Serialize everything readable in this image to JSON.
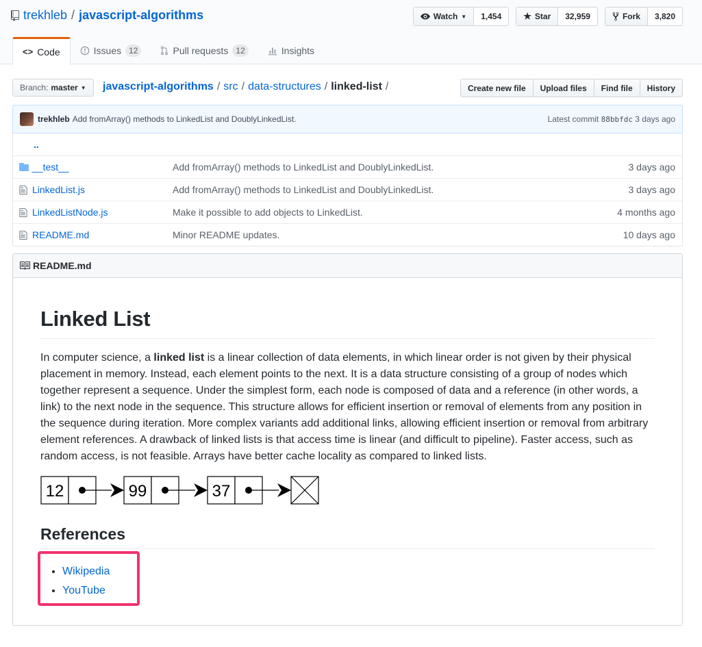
{
  "repo": {
    "owner": "trekhleb",
    "separator": "/",
    "name": "javascript-algorithms"
  },
  "actions": [
    {
      "label": "Watch",
      "icon": "eye-icon",
      "caret": true,
      "count": "1,454"
    },
    {
      "label": "Star",
      "icon": "star-icon",
      "caret": false,
      "count": "32,959"
    },
    {
      "label": "Fork",
      "icon": "fork-icon",
      "caret": false,
      "count": "3,820"
    }
  ],
  "nav": [
    {
      "label": "Code",
      "icon": "code-icon",
      "count": ""
    },
    {
      "label": "Issues",
      "icon": "issue-icon",
      "count": "12"
    },
    {
      "label": "Pull requests",
      "icon": "pull-request-icon",
      "count": "12"
    },
    {
      "label": "Insights",
      "icon": "graph-icon",
      "count": ""
    }
  ],
  "branch": {
    "label": "Branch:",
    "value": "master"
  },
  "breadcrumb": {
    "root": "javascript-algorithms",
    "segments": [
      "src",
      "data-structures"
    ],
    "current": "linked-list"
  },
  "file_buttons": [
    "Create new file",
    "Upload files",
    "Find file",
    "History"
  ],
  "commit": {
    "author": "trekhleb",
    "message": "Add fromArray() methods to LinkedList and DoublyLinkedList.",
    "latest_label": "Latest commit",
    "sha": "88bbfdc",
    "age": "3 days ago"
  },
  "files": [
    {
      "type": "dir",
      "name": "__test__",
      "message": "Add fromArray() methods to LinkedList and DoublyLinkedList.",
      "age": "3 days ago"
    },
    {
      "type": "file",
      "name": "LinkedList.js",
      "message": "Add fromArray() methods to LinkedList and DoublyLinkedList.",
      "age": "3 days ago"
    },
    {
      "type": "file",
      "name": "LinkedListNode.js",
      "message": "Make it possible to add objects to LinkedList.",
      "age": "4 months ago"
    },
    {
      "type": "file",
      "name": "README.md",
      "message": "Minor README updates.",
      "age": "10 days ago"
    }
  ],
  "up_link": "..",
  "readme": {
    "filename": "README.md",
    "title": "Linked List",
    "para_pre": "In computer science, a ",
    "para_bold": "linked list",
    "para_post": " is a linear collection of data elements, in which linear order is not given by their physical placement in memory. Instead, each element points to the next. It is a data structure consisting of a group of nodes which together represent a sequence. Under the simplest form, each node is composed of data and a reference (in other words, a link) to the next node in the sequence. This structure allows for efficient insertion or removal of elements from any position in the sequence during iteration. More complex variants add additional links, allowing efficient insertion or removal from arbitrary element references. A drawback of linked lists is that access time is linear (and difficult to pipeline). Faster access, such as random access, is not feasible. Arrays have better cache locality as compared to linked lists.",
    "diagram_nodes": [
      "12",
      "99",
      "37"
    ],
    "references_title": "References",
    "references": [
      "Wikipedia",
      "YouTube"
    ]
  },
  "colors": {
    "link": "#0366d6",
    "highlight": "#f0336e",
    "tab_accent": "#e36209"
  }
}
